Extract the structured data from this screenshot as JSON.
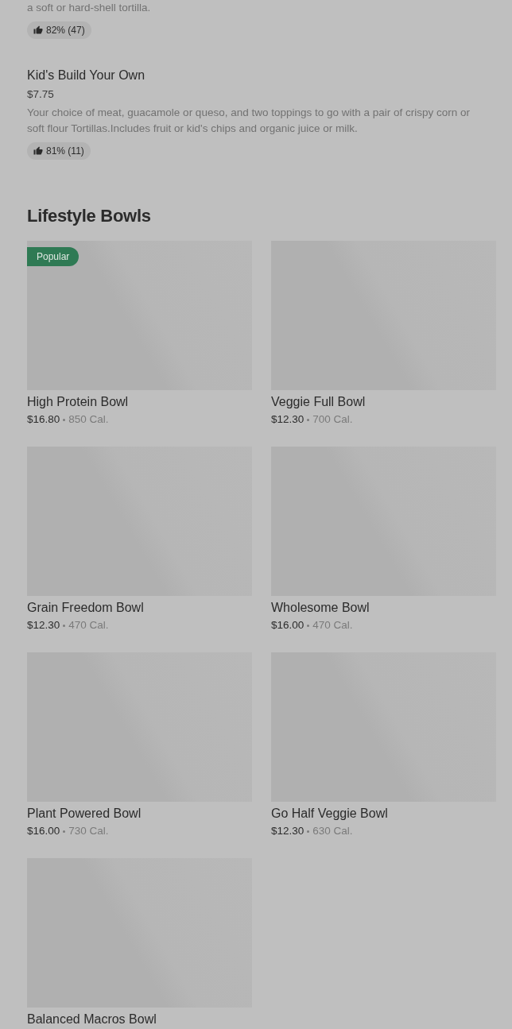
{
  "items": [
    {
      "description": "a soft or hard-shell tortilla.",
      "rating": "82% (47)"
    },
    {
      "name": "Kid's Build Your Own",
      "price": "$7.75",
      "description": "Your choice of meat, guacamole or queso, and two toppings to go with a pair of crispy corn or soft flour Tortillas.Includes fruit or kid's chips and organic juice or milk.",
      "rating": "81% (11)"
    }
  ],
  "section": {
    "title": "Lifestyle Bowls",
    "cards": [
      {
        "name": "High Protein Bowl",
        "price": "$16.80",
        "calories": "850 Cal.",
        "tag": "Popular"
      },
      {
        "name": "Veggie Full Bowl",
        "price": "$12.30",
        "calories": "700 Cal."
      },
      {
        "name": "Grain Freedom Bowl",
        "price": "$12.30",
        "calories": "470 Cal."
      },
      {
        "name": "Wholesome Bowl",
        "price": "$16.00",
        "calories": "470 Cal."
      },
      {
        "name": "Plant Powered Bowl",
        "price": "$16.00",
        "calories": "730 Cal."
      },
      {
        "name": "Go Half Veggie Bowl",
        "price": "$12.30",
        "calories": "630 Cal."
      },
      {
        "name": "Balanced Macros Bowl"
      }
    ]
  }
}
